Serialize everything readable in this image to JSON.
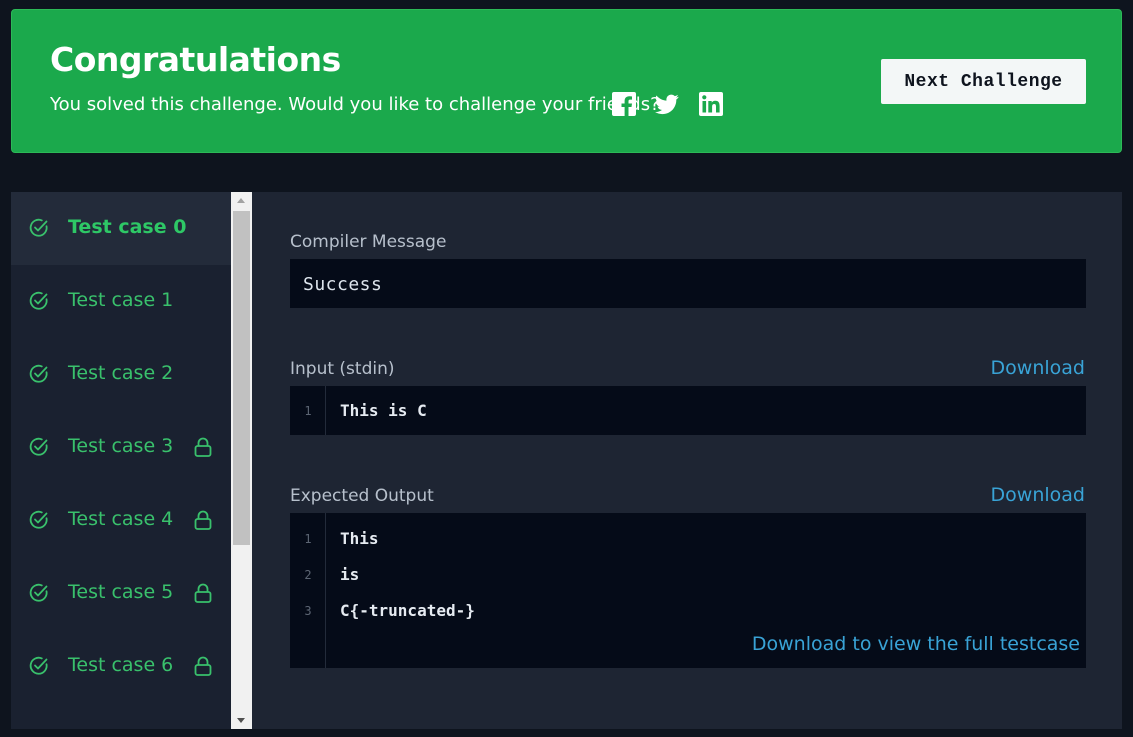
{
  "banner": {
    "title": "Congratulations",
    "subtitle": "You solved this challenge. Would you like to challenge your friends?",
    "share_icons": [
      "facebook-icon",
      "twitter-icon",
      "linkedin-icon"
    ],
    "next_button_label": "Next Challenge",
    "background_color": "#1ba94c"
  },
  "sidebar": {
    "items": [
      {
        "label": "Test case 0",
        "status": "passed",
        "locked": false,
        "active": true
      },
      {
        "label": "Test case 1",
        "status": "passed",
        "locked": false,
        "active": false
      },
      {
        "label": "Test case 2",
        "status": "passed",
        "locked": false,
        "active": false
      },
      {
        "label": "Test case 3",
        "status": "passed",
        "locked": true,
        "active": false
      },
      {
        "label": "Test case 4",
        "status": "passed",
        "locked": true,
        "active": false
      },
      {
        "label": "Test case 5",
        "status": "passed",
        "locked": true,
        "active": false
      },
      {
        "label": "Test case 6",
        "status": "passed",
        "locked": true,
        "active": false
      }
    ],
    "pass_color": "#39c16c"
  },
  "main": {
    "compiler": {
      "label": "Compiler Message",
      "value": "Success"
    },
    "input": {
      "label": "Input (stdin)",
      "download_label": "Download",
      "lines": [
        {
          "n": "1",
          "text": "This is C"
        }
      ]
    },
    "expected": {
      "label": "Expected Output",
      "download_label": "Download",
      "lines": [
        {
          "n": "1",
          "text": "This"
        },
        {
          "n": "2",
          "text": "is"
        },
        {
          "n": "3",
          "text": "C{-truncated-}"
        }
      ],
      "full_link": "Download to view the full testcase"
    },
    "link_color": "#39a3d6"
  }
}
